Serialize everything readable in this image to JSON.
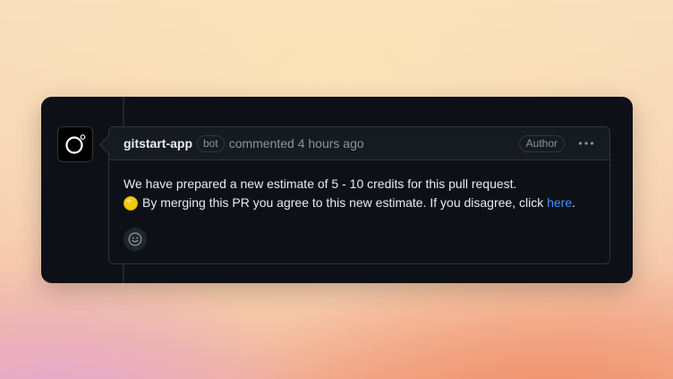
{
  "comment": {
    "author": "gitstart-app",
    "bot_badge": "bot",
    "meta": "commented 4 hours ago",
    "author_badge": "Author",
    "body_line1": "We have prepared a new estimate of 5 - 10 credits for this pull request.",
    "body_line2_prefix": "By merging this PR you agree to this new estimate. If you disagree, click",
    "link_text": "here",
    "body_line2_suffix": ".",
    "coin_icon": "yellow-circle-emoji",
    "more_icon": "kebab-horizontal-icon",
    "reaction_icon": "smiley-icon"
  },
  "colors": {
    "card_background": "#0d1117",
    "header_background": "#161b22",
    "border": "#30363d",
    "text_primary": "#e6edf3",
    "text_muted": "#8b949e",
    "link": "#4493f8",
    "coin": "#f2cc0c"
  }
}
